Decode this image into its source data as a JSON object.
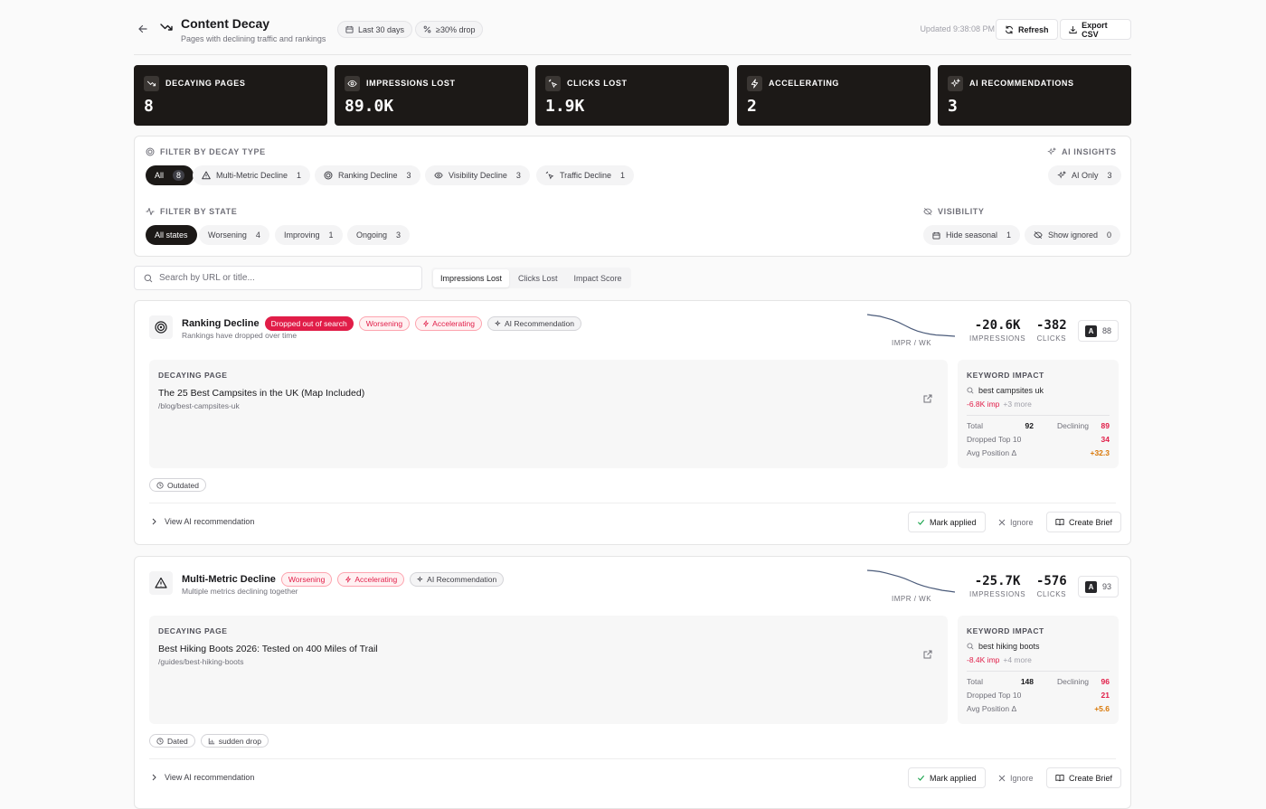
{
  "header": {
    "title": "Content Decay",
    "subtitle": "Pages with declining traffic and rankings",
    "pill_range": "Last 30 days",
    "pill_drop": "≥30% drop",
    "updated": "Updated 9:38:08 PM",
    "refresh_label": "Refresh",
    "export_label": "Export CSV"
  },
  "stats": [
    {
      "label": "DECAYING PAGES",
      "value": "8",
      "icon": "trending-down-icon"
    },
    {
      "label": "IMPRESSIONS LOST",
      "value": "89.0K",
      "icon": "eye-icon"
    },
    {
      "label": "CLICKS LOST",
      "value": "1.9K",
      "icon": "cursor-click-icon"
    },
    {
      "label": "ACCELERATING",
      "value": "2",
      "icon": "zap-icon"
    },
    {
      "label": "AI RECOMMENDATIONS",
      "value": "3",
      "icon": "sparkles-icon"
    }
  ],
  "filters": {
    "decay_type_label": "FILTER BY DECAY TYPE",
    "decay_types": [
      {
        "label": "All",
        "count": "8"
      },
      {
        "label": "Multi-Metric Decline",
        "count": "1"
      },
      {
        "label": "Ranking Decline",
        "count": "3"
      },
      {
        "label": "Visibility Decline",
        "count": "3"
      },
      {
        "label": "Traffic Decline",
        "count": "1"
      }
    ],
    "ai_label": "AI INSIGHTS",
    "ai_only": {
      "label": "AI Only",
      "count": "3"
    },
    "state_label": "FILTER BY STATE",
    "states": [
      {
        "label": "All states",
        "count": ""
      },
      {
        "label": "Worsening",
        "count": "4"
      },
      {
        "label": "Improving",
        "count": "1"
      },
      {
        "label": "Ongoing",
        "count": "3"
      }
    ],
    "visibility_label": "VISIBILITY",
    "hide_seasonal": {
      "label": "Hide seasonal",
      "count": "1"
    },
    "show_ignored": {
      "label": "Show ignored",
      "count": "0"
    }
  },
  "search": {
    "placeholder": "Search by URL or title..."
  },
  "sort_tabs": [
    "Impressions Lost",
    "Clicks Lost",
    "Impact Score"
  ],
  "cards": [
    {
      "type": "Ranking Decline",
      "desc": "Rankings have dropped over time",
      "badges": [
        "Dropped out of search",
        "Worsening",
        "Accelerating",
        "AI Recommendation"
      ],
      "spark_label": "IMPR / WK",
      "spark": [
        10,
        10.4,
        10.8,
        11.6,
        12.4,
        13.6,
        15,
        16.4,
        17.6,
        18.4,
        19,
        19.4,
        19.6,
        19.8,
        20
      ],
      "impressions": "-20.6K",
      "impressions_label": "IMPRESSIONS",
      "clicks": "-382",
      "clicks_label": "CLICKS",
      "grade": "A",
      "score": "88",
      "page_label": "DECAYING PAGE",
      "page_title": "The 25 Best Campsites in the UK (Map Included)",
      "page_url": "/blog/best-campsites-uk",
      "kw_label": "KEYWORD IMPACT",
      "kw_term": "best campsites uk",
      "kw_imp": "-6.8K imp",
      "kw_more": "+3 more",
      "total_label": "Total",
      "total": "92",
      "declining_label": "Declining",
      "declining": "89",
      "dropped_label": "Dropped Top 10",
      "dropped": "34",
      "avgpos_label": "Avg Position Δ",
      "avgpos": "+32.3",
      "tags": [
        "Outdated"
      ],
      "view_ai": "View AI recommendation",
      "mark_applied": "Mark applied",
      "ignore": "Ignore",
      "create_brief": "Create Brief"
    },
    {
      "type": "Multi-Metric Decline",
      "desc": "Multiple metrics declining together",
      "badges": [
        "Worsening",
        "Accelerating",
        "AI Recommendation"
      ],
      "spark_label": "IMPR / WK",
      "spark": [
        10,
        10.2,
        10.6,
        11.2,
        12,
        12.8,
        13.8,
        15,
        16.2,
        17.2,
        18,
        18.6,
        19.2,
        19.6,
        20
      ],
      "impressions": "-25.7K",
      "impressions_label": "IMPRESSIONS",
      "clicks": "-576",
      "clicks_label": "CLICKS",
      "grade": "A",
      "score": "93",
      "page_label": "DECAYING PAGE",
      "page_title": "Best Hiking Boots 2026: Tested on 400 Miles of Trail",
      "page_url": "/guides/best-hiking-boots",
      "kw_label": "KEYWORD IMPACT",
      "kw_term": "best hiking boots",
      "kw_imp": "-8.4K imp",
      "kw_more": "+4 more",
      "total_label": "Total",
      "total": "148",
      "declining_label": "Declining",
      "declining": "96",
      "dropped_label": "Dropped Top 10",
      "dropped": "21",
      "avgpos_label": "Avg Position Δ",
      "avgpos": "+5.6",
      "tags": [
        "Dated",
        "sudden drop"
      ],
      "view_ai": "View AI recommendation",
      "mark_applied": "Mark applied",
      "ignore": "Ignore",
      "create_brief": "Create Brief"
    }
  ],
  "colors": {
    "dark": "#1c1917",
    "red": "#e11d48",
    "orange": "#d97706",
    "spark": "#4b5b7a"
  }
}
